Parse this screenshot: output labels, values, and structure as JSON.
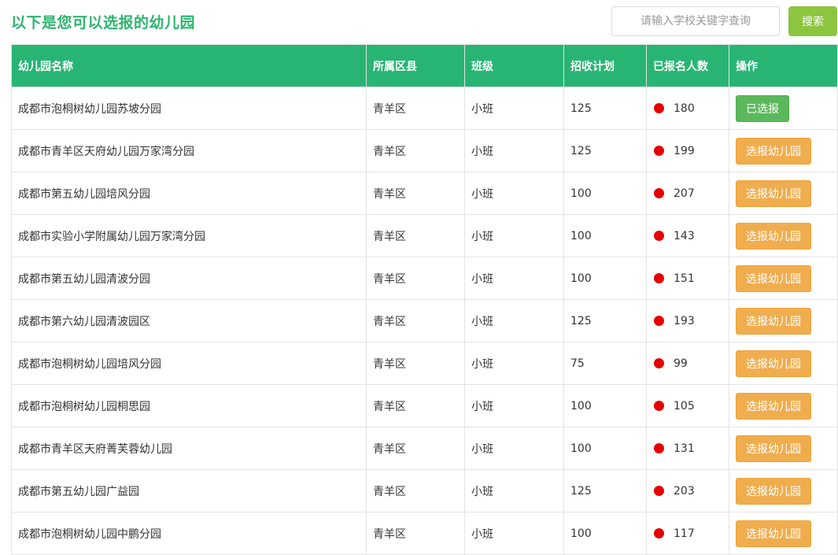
{
  "page_title": "以下是您可以选报的幼儿园",
  "search": {
    "placeholder": "请输入学校关键字查询",
    "button_label": "搜索"
  },
  "table": {
    "headers": [
      "幼儿园名称",
      "所属区县",
      "班级",
      "招收计划",
      "已报名人数",
      "操作"
    ],
    "rows": [
      {
        "name": "成都市泡桐树幼儿园苏坡分园",
        "district": "青羊区",
        "class": "小班",
        "plan": "125",
        "count": "180",
        "action": "已选报",
        "selected": true
      },
      {
        "name": "成都市青羊区天府幼儿园万家湾分园",
        "district": "青羊区",
        "class": "小班",
        "plan": "125",
        "count": "199",
        "action": "选报幼儿园",
        "selected": false
      },
      {
        "name": "成都市第五幼儿园培风分园",
        "district": "青羊区",
        "class": "小班",
        "plan": "100",
        "count": "207",
        "action": "选报幼儿园",
        "selected": false
      },
      {
        "name": "成都市实验小学附属幼儿园万家湾分园",
        "district": "青羊区",
        "class": "小班",
        "plan": "100",
        "count": "143",
        "action": "选报幼儿园",
        "selected": false
      },
      {
        "name": "成都市第五幼儿园清波分园",
        "district": "青羊区",
        "class": "小班",
        "plan": "100",
        "count": "151",
        "action": "选报幼儿园",
        "selected": false
      },
      {
        "name": "成都市第六幼儿园清波园区",
        "district": "青羊区",
        "class": "小班",
        "plan": "125",
        "count": "193",
        "action": "选报幼儿园",
        "selected": false
      },
      {
        "name": "成都市泡桐树幼儿园培风分园",
        "district": "青羊区",
        "class": "小班",
        "plan": "75",
        "count": "99",
        "action": "选报幼儿园",
        "selected": false
      },
      {
        "name": "成都市泡桐树幼儿园桐思园",
        "district": "青羊区",
        "class": "小班",
        "plan": "100",
        "count": "105",
        "action": "选报幼儿园",
        "selected": false
      },
      {
        "name": "成都市青羊区天府菁芙蓉幼儿园",
        "district": "青羊区",
        "class": "小班",
        "plan": "100",
        "count": "131",
        "action": "选报幼儿园",
        "selected": false
      },
      {
        "name": "成都市第五幼儿园广益园",
        "district": "青羊区",
        "class": "小班",
        "plan": "125",
        "count": "203",
        "action": "选报幼儿园",
        "selected": false
      },
      {
        "name": "成都市泡桐树幼儿园中鹏分园",
        "district": "青羊区",
        "class": "小班",
        "plan": "100",
        "count": "117",
        "action": "选报幼儿园",
        "selected": false
      }
    ]
  },
  "colors": {
    "title_green": "#2db56e",
    "header_green": "#28b573",
    "search_button": "#8cc63f",
    "selected_button": "#5cb85c",
    "select_button": "#f0ad4e",
    "status_dot": "#e60000"
  }
}
